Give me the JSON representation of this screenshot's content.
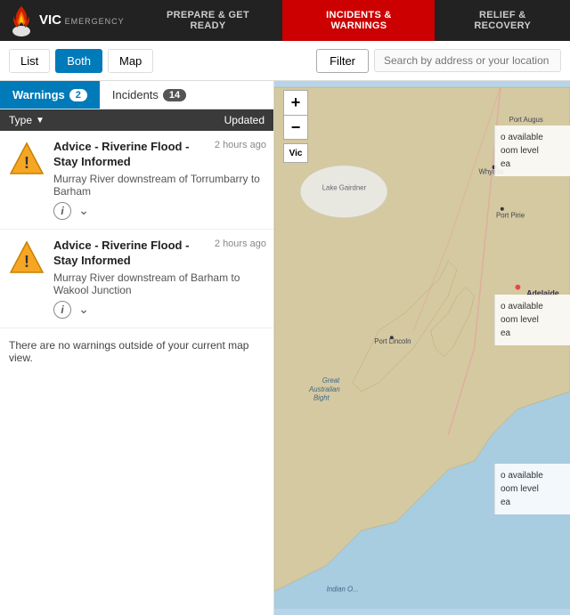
{
  "header": {
    "logo_vic": "VIC",
    "logo_emergency": "EMERGENCY",
    "nav": [
      {
        "id": "prepare",
        "label": "PREPARE & GET READY",
        "active": false
      },
      {
        "id": "incidents",
        "label": "INCIDENTS & WARNINGS",
        "active": true
      },
      {
        "id": "relief",
        "label": "RELIEF & RECOVERY",
        "active": false
      }
    ]
  },
  "toolbar": {
    "list_label": "List",
    "both_label": "Both",
    "map_label": "Map",
    "filter_label": "Filter",
    "search_placeholder": "Search by address or your location"
  },
  "sub_tabs": [
    {
      "id": "warnings",
      "label": "Warnings",
      "count": 2,
      "active": true
    },
    {
      "id": "incidents",
      "label": "Incidents",
      "count": 14,
      "active": false
    }
  ],
  "list_header": {
    "type_label": "Type",
    "updated_label": "Updated"
  },
  "warnings": [
    {
      "id": 1,
      "title": "Advice - Riverine Flood - Stay Informed",
      "subtitle": "Murray River downstream of Torrumbarry to Barham",
      "time": "2 hours ago"
    },
    {
      "id": 2,
      "title": "Advice - Riverine Flood - Stay Informed",
      "subtitle": "Murray River downstream of Barham to Wakool Junction",
      "time": "2 hours ago"
    }
  ],
  "no_warnings_msg": "There are no warnings outside of your current map view.",
  "map_controls": {
    "zoom_in": "+",
    "zoom_out": "−",
    "vic_label": "Vic"
  },
  "side_details": [
    "o available\noom level\nea",
    "o available\noom level\nea",
    "o available\noom level\nea"
  ],
  "map_labels": {
    "lake_gairdner": "Lake Gairdner",
    "port_augustus": "Port Augus",
    "whyalla": "Whyalla",
    "port_pirie": "Port Pirie",
    "great_australian_bight": "Great Australian Bight",
    "port_lincoln": "Port Lincoln",
    "adelaide": "Adelaide",
    "indian_ocean": "Indian O..."
  }
}
